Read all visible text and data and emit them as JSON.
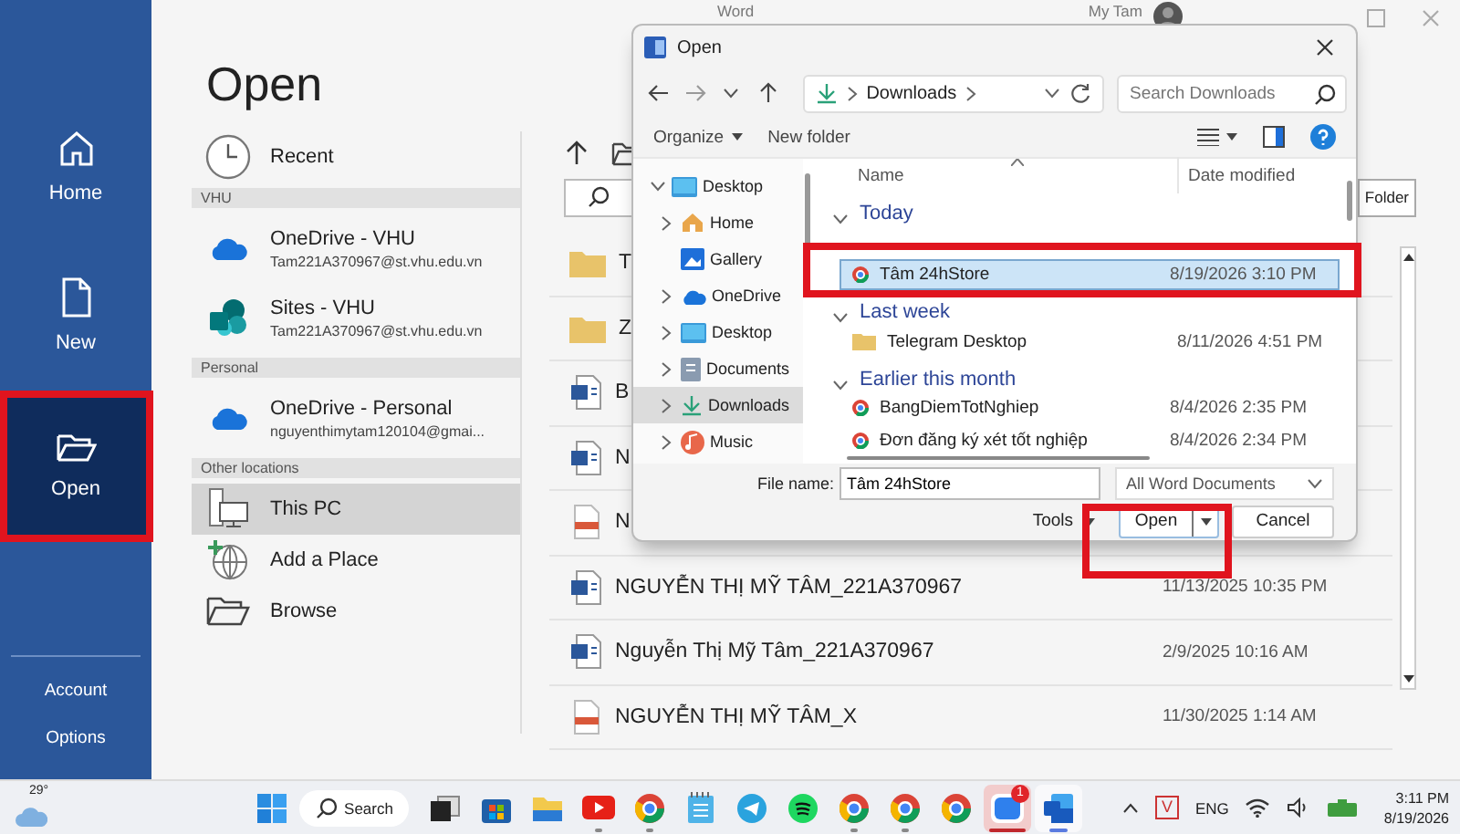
{
  "window": {
    "app_title": "Word",
    "user": "My Tam"
  },
  "nav": {
    "items": [
      {
        "kind": "home",
        "label": "Home",
        "selected": false
      },
      {
        "kind": "new",
        "label": "New",
        "selected": false
      },
      {
        "kind": "open",
        "label": "Open",
        "selected": true
      }
    ],
    "footer": [
      "Account",
      "Options"
    ]
  },
  "heading": "Open",
  "places": [
    {
      "kind": "recent",
      "label": "Recent",
      "selected": false
    },
    {
      "kind": "header",
      "label": "VHU"
    },
    {
      "kind": "onedrive",
      "label": "OneDrive - VHU",
      "account": "Tam221A370967@st.vhu.edu.vn",
      "selected": false
    },
    {
      "kind": "sites",
      "label": "Sites - VHU",
      "account": "Tam221A370967@st.vhu.edu.vn",
      "selected": false
    },
    {
      "kind": "header",
      "label": "Personal"
    },
    {
      "kind": "onedrive",
      "label": "OneDrive - Personal",
      "account": "nguyenthimytam120104@gmai...",
      "selected": false
    },
    {
      "kind": "header",
      "label": "Other locations"
    },
    {
      "kind": "thispc",
      "label": "This PC",
      "selected": true
    },
    {
      "kind": "addplace",
      "label": "Add a Place",
      "selected": false
    },
    {
      "kind": "browse",
      "label": "Browse",
      "selected": false
    }
  ],
  "files": {
    "button": "Folder",
    "rows": [
      {
        "kind": "folder",
        "name": "T"
      },
      {
        "kind": "folder",
        "name": "Z"
      },
      {
        "kind": "word",
        "name": "B"
      },
      {
        "kind": "word",
        "name": "N"
      },
      {
        "kind": "pdf",
        "name": "N"
      },
      {
        "kind": "word",
        "name": "NGUYỄN THỊ MỸ TÂM_221A370967",
        "date": "11/13/2025 10:35 PM"
      },
      {
        "kind": "word",
        "name": "Nguyễn Thị Mỹ Tâm_221A370967",
        "date": "2/9/2025 10:16 AM"
      },
      {
        "kind": "pdf",
        "name": "NGUYỄN THỊ MỸ TÂM_X",
        "date": "11/30/2025 1:14 AM"
      }
    ]
  },
  "dialog": {
    "title": "Open",
    "location": "Downloads",
    "search_placeholder": "Search Downloads",
    "commands": [
      "Organize",
      "New folder"
    ],
    "tree": [
      {
        "kind": "desktop",
        "label": "Desktop",
        "expanded": true,
        "selected": false,
        "children": [
          {
            "kind": "home",
            "label": "Home",
            "expanded": false,
            "selected": false
          },
          {
            "kind": "gallery",
            "label": "Gallery",
            "selected": false
          },
          {
            "kind": "onedrive",
            "label": "OneDrive",
            "expanded": false,
            "selected": false
          },
          {
            "kind": "desktop",
            "label": "Desktop",
            "expanded": false,
            "selected": false
          },
          {
            "kind": "documents",
            "label": "Documents",
            "expanded": false,
            "selected": false
          },
          {
            "kind": "downloads",
            "label": "Downloads",
            "expanded": false,
            "selected": true
          },
          {
            "kind": "music",
            "label": "Music",
            "expanded": false,
            "selected": false
          }
        ]
      }
    ],
    "columns": [
      "Name",
      "Date modified"
    ],
    "groups": [
      {
        "label": "Today",
        "expanded": true,
        "files": [
          {
            "kind": "browser",
            "name": "Tâm 24hStore",
            "date": "8/19/2026 3:10 PM",
            "selected": true
          }
        ]
      },
      {
        "label": "Last week",
        "expanded": true,
        "files": [
          {
            "kind": "folder",
            "name": "Telegram Desktop",
            "date": "8/11/2026 4:51 PM",
            "selected": false
          }
        ]
      },
      {
        "label": "Earlier this month",
        "expanded": true,
        "files": [
          {
            "kind": "browser",
            "name": "BangDiemTotNghiep",
            "date": "8/4/2026 2:35 PM",
            "selected": false
          },
          {
            "kind": "browser",
            "name": "Đơn đăng ký xét tốt nghiệp",
            "date": "8/4/2026 2:34 PM",
            "selected": false
          }
        ]
      }
    ],
    "file_name_label": "File name:",
    "file_name": "Tâm 24hStore",
    "file_type": "All Word Documents",
    "tools": "Tools",
    "open": "Open",
    "cancel": "Cancel"
  },
  "taskbar": {
    "temperature": "29°",
    "search": "Search",
    "apps": [
      {
        "kind": "taskview",
        "running": false,
        "active": false,
        "flashing": false
      },
      {
        "kind": "store",
        "running": false,
        "active": false,
        "flashing": false
      },
      {
        "kind": "explorer",
        "running": false,
        "active": false,
        "flashing": false
      },
      {
        "kind": "youtube",
        "running": true,
        "active": false,
        "flashing": false
      },
      {
        "kind": "chrome",
        "running": true,
        "active": false,
        "flashing": false
      },
      {
        "kind": "notepad",
        "running": false,
        "active": false,
        "flashing": false
      },
      {
        "kind": "telegram",
        "running": false,
        "active": false,
        "flashing": false
      },
      {
        "kind": "spotify",
        "running": false,
        "active": false,
        "flashing": false
      },
      {
        "kind": "chrome",
        "running": true,
        "active": false,
        "flashing": false
      },
      {
        "kind": "chrome",
        "running": true,
        "active": false,
        "flashing": false
      },
      {
        "kind": "chrome",
        "running": false,
        "active": false,
        "flashing": false
      },
      {
        "kind": "zalo",
        "running": true,
        "active": false,
        "flashing": true,
        "badge": "1"
      },
      {
        "kind": "word",
        "running": true,
        "active": true,
        "flashing": false
      }
    ],
    "tray": {
      "app": "V",
      "language": "ENG",
      "time": "3:11 PM",
      "date": "8/19/2026"
    }
  }
}
